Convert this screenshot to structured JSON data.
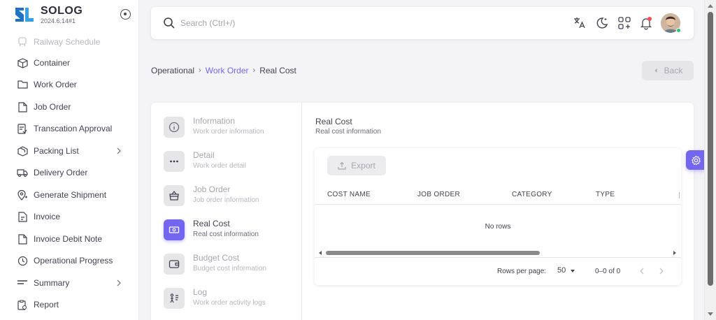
{
  "brand": {
    "name": "SOLOG",
    "version": "2024.6.14#1"
  },
  "sidebar": {
    "items": [
      {
        "label": "Railway Schedule",
        "icon": "train-icon"
      },
      {
        "label": "Container",
        "icon": "box-icon"
      },
      {
        "label": "Work Order",
        "icon": "folder-icon"
      },
      {
        "label": "Job Order",
        "icon": "file-icon"
      },
      {
        "label": "Transcation Approval",
        "icon": "file-check-icon"
      },
      {
        "label": "Packing List",
        "icon": "package-icon"
      },
      {
        "label": "Delivery Order",
        "icon": "truck-icon"
      },
      {
        "label": "Generate Shipment",
        "icon": "map-pin-icon"
      },
      {
        "label": "Invoice",
        "icon": "invoice-icon"
      },
      {
        "label": "Invoice Debit Note",
        "icon": "file-text-icon"
      },
      {
        "label": "Operational Progress",
        "icon": "progress-icon"
      },
      {
        "label": "Summary",
        "icon": "summary-icon"
      },
      {
        "label": "Report",
        "icon": "clipboard-icon"
      }
    ]
  },
  "topbar": {
    "search_placeholder": "Search (Ctrl+/)",
    "icons": [
      "translate-icon",
      "moon-icon",
      "apps-icon",
      "bell-icon"
    ]
  },
  "breadcrumb": {
    "root": "Operational",
    "parent": "Work Order",
    "current": "Real Cost"
  },
  "back_label": "Back",
  "steps": [
    {
      "title": "Information",
      "subtitle": "Work order information",
      "icon": "info-icon"
    },
    {
      "title": "Detail",
      "subtitle": "Work order detail",
      "icon": "dots-icon"
    },
    {
      "title": "Job Order",
      "subtitle": "Job order information",
      "icon": "basket-icon"
    },
    {
      "title": "Real Cost",
      "subtitle": "Real cost information",
      "icon": "cash-icon"
    },
    {
      "title": "Budget Cost",
      "subtitle": "Budget cost information",
      "icon": "wallet-icon"
    },
    {
      "title": "Log",
      "subtitle": "Work order activity logs",
      "icon": "log-icon"
    }
  ],
  "active_step": "Real Cost",
  "content": {
    "title": "Real Cost",
    "subtitle": "Real cost information",
    "export_label": "Export",
    "columns": [
      "COST NAME",
      "JOB ORDER",
      "CATEGORY",
      "TYPE"
    ],
    "empty_text": "No rows",
    "rows_per_page_label": "Rows per page:",
    "rows_per_page": "50",
    "page_range": "0–0 of 0"
  },
  "colors": {
    "primary": "#7367f0",
    "notification": "#ff4c51",
    "online": "#28c76f"
  }
}
